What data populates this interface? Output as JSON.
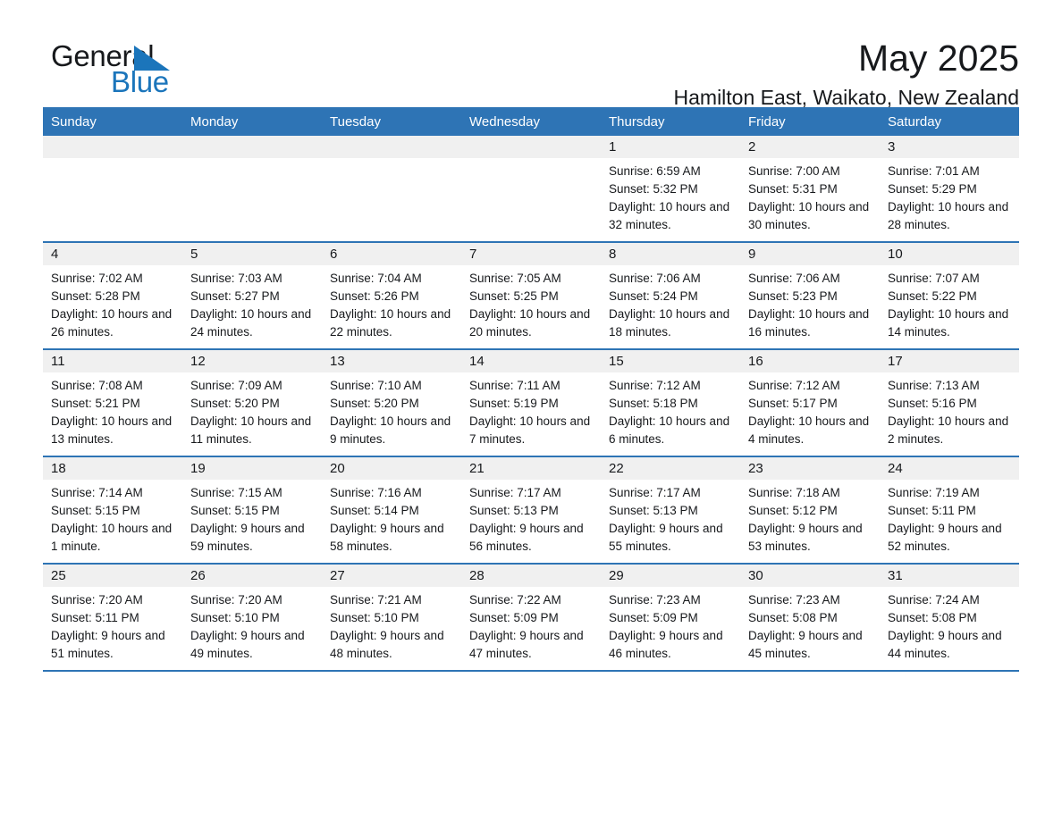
{
  "brand": {
    "name_part1": "General",
    "name_part2": "Blue",
    "accent_color": "#1b75bb",
    "triangle_icon": "triangle-icon"
  },
  "header": {
    "month_title": "May 2025",
    "location": "Hamilton East, Waikato, New Zealand"
  },
  "theme": {
    "header_blue": "#2e74b5",
    "day_band_gray": "#f0f0f0",
    "text_color": "#17191c"
  },
  "weekdays": [
    "Sunday",
    "Monday",
    "Tuesday",
    "Wednesday",
    "Thursday",
    "Friday",
    "Saturday"
  ],
  "weeks": [
    [
      {
        "day": "",
        "empty": true,
        "sunrise": "",
        "sunset": "",
        "daylight": ""
      },
      {
        "day": "",
        "empty": true,
        "sunrise": "",
        "sunset": "",
        "daylight": ""
      },
      {
        "day": "",
        "empty": true,
        "sunrise": "",
        "sunset": "",
        "daylight": ""
      },
      {
        "day": "",
        "empty": true,
        "sunrise": "",
        "sunset": "",
        "daylight": ""
      },
      {
        "day": "1",
        "empty": false,
        "sunrise": "Sunrise: 6:59 AM",
        "sunset": "Sunset: 5:32 PM",
        "daylight": "Daylight: 10 hours and 32 minutes."
      },
      {
        "day": "2",
        "empty": false,
        "sunrise": "Sunrise: 7:00 AM",
        "sunset": "Sunset: 5:31 PM",
        "daylight": "Daylight: 10 hours and 30 minutes."
      },
      {
        "day": "3",
        "empty": false,
        "sunrise": "Sunrise: 7:01 AM",
        "sunset": "Sunset: 5:29 PM",
        "daylight": "Daylight: 10 hours and 28 minutes."
      }
    ],
    [
      {
        "day": "4",
        "empty": false,
        "sunrise": "Sunrise: 7:02 AM",
        "sunset": "Sunset: 5:28 PM",
        "daylight": "Daylight: 10 hours and 26 minutes."
      },
      {
        "day": "5",
        "empty": false,
        "sunrise": "Sunrise: 7:03 AM",
        "sunset": "Sunset: 5:27 PM",
        "daylight": "Daylight: 10 hours and 24 minutes."
      },
      {
        "day": "6",
        "empty": false,
        "sunrise": "Sunrise: 7:04 AM",
        "sunset": "Sunset: 5:26 PM",
        "daylight": "Daylight: 10 hours and 22 minutes."
      },
      {
        "day": "7",
        "empty": false,
        "sunrise": "Sunrise: 7:05 AM",
        "sunset": "Sunset: 5:25 PM",
        "daylight": "Daylight: 10 hours and 20 minutes."
      },
      {
        "day": "8",
        "empty": false,
        "sunrise": "Sunrise: 7:06 AM",
        "sunset": "Sunset: 5:24 PM",
        "daylight": "Daylight: 10 hours and 18 minutes."
      },
      {
        "day": "9",
        "empty": false,
        "sunrise": "Sunrise: 7:06 AM",
        "sunset": "Sunset: 5:23 PM",
        "daylight": "Daylight: 10 hours and 16 minutes."
      },
      {
        "day": "10",
        "empty": false,
        "sunrise": "Sunrise: 7:07 AM",
        "sunset": "Sunset: 5:22 PM",
        "daylight": "Daylight: 10 hours and 14 minutes."
      }
    ],
    [
      {
        "day": "11",
        "empty": false,
        "sunrise": "Sunrise: 7:08 AM",
        "sunset": "Sunset: 5:21 PM",
        "daylight": "Daylight: 10 hours and 13 minutes."
      },
      {
        "day": "12",
        "empty": false,
        "sunrise": "Sunrise: 7:09 AM",
        "sunset": "Sunset: 5:20 PM",
        "daylight": "Daylight: 10 hours and 11 minutes."
      },
      {
        "day": "13",
        "empty": false,
        "sunrise": "Sunrise: 7:10 AM",
        "sunset": "Sunset: 5:20 PM",
        "daylight": "Daylight: 10 hours and 9 minutes."
      },
      {
        "day": "14",
        "empty": false,
        "sunrise": "Sunrise: 7:11 AM",
        "sunset": "Sunset: 5:19 PM",
        "daylight": "Daylight: 10 hours and 7 minutes."
      },
      {
        "day": "15",
        "empty": false,
        "sunrise": "Sunrise: 7:12 AM",
        "sunset": "Sunset: 5:18 PM",
        "daylight": "Daylight: 10 hours and 6 minutes."
      },
      {
        "day": "16",
        "empty": false,
        "sunrise": "Sunrise: 7:12 AM",
        "sunset": "Sunset: 5:17 PM",
        "daylight": "Daylight: 10 hours and 4 minutes."
      },
      {
        "day": "17",
        "empty": false,
        "sunrise": "Sunrise: 7:13 AM",
        "sunset": "Sunset: 5:16 PM",
        "daylight": "Daylight: 10 hours and 2 minutes."
      }
    ],
    [
      {
        "day": "18",
        "empty": false,
        "sunrise": "Sunrise: 7:14 AM",
        "sunset": "Sunset: 5:15 PM",
        "daylight": "Daylight: 10 hours and 1 minute."
      },
      {
        "day": "19",
        "empty": false,
        "sunrise": "Sunrise: 7:15 AM",
        "sunset": "Sunset: 5:15 PM",
        "daylight": "Daylight: 9 hours and 59 minutes."
      },
      {
        "day": "20",
        "empty": false,
        "sunrise": "Sunrise: 7:16 AM",
        "sunset": "Sunset: 5:14 PM",
        "daylight": "Daylight: 9 hours and 58 minutes."
      },
      {
        "day": "21",
        "empty": false,
        "sunrise": "Sunrise: 7:17 AM",
        "sunset": "Sunset: 5:13 PM",
        "daylight": "Daylight: 9 hours and 56 minutes."
      },
      {
        "day": "22",
        "empty": false,
        "sunrise": "Sunrise: 7:17 AM",
        "sunset": "Sunset: 5:13 PM",
        "daylight": "Daylight: 9 hours and 55 minutes."
      },
      {
        "day": "23",
        "empty": false,
        "sunrise": "Sunrise: 7:18 AM",
        "sunset": "Sunset: 5:12 PM",
        "daylight": "Daylight: 9 hours and 53 minutes."
      },
      {
        "day": "24",
        "empty": false,
        "sunrise": "Sunrise: 7:19 AM",
        "sunset": "Sunset: 5:11 PM",
        "daylight": "Daylight: 9 hours and 52 minutes."
      }
    ],
    [
      {
        "day": "25",
        "empty": false,
        "sunrise": "Sunrise: 7:20 AM",
        "sunset": "Sunset: 5:11 PM",
        "daylight": "Daylight: 9 hours and 51 minutes."
      },
      {
        "day": "26",
        "empty": false,
        "sunrise": "Sunrise: 7:20 AM",
        "sunset": "Sunset: 5:10 PM",
        "daylight": "Daylight: 9 hours and 49 minutes."
      },
      {
        "day": "27",
        "empty": false,
        "sunrise": "Sunrise: 7:21 AM",
        "sunset": "Sunset: 5:10 PM",
        "daylight": "Daylight: 9 hours and 48 minutes."
      },
      {
        "day": "28",
        "empty": false,
        "sunrise": "Sunrise: 7:22 AM",
        "sunset": "Sunset: 5:09 PM",
        "daylight": "Daylight: 9 hours and 47 minutes."
      },
      {
        "day": "29",
        "empty": false,
        "sunrise": "Sunrise: 7:23 AM",
        "sunset": "Sunset: 5:09 PM",
        "daylight": "Daylight: 9 hours and 46 minutes."
      },
      {
        "day": "30",
        "empty": false,
        "sunrise": "Sunrise: 7:23 AM",
        "sunset": "Sunset: 5:08 PM",
        "daylight": "Daylight: 9 hours and 45 minutes."
      },
      {
        "day": "31",
        "empty": false,
        "sunrise": "Sunrise: 7:24 AM",
        "sunset": "Sunset: 5:08 PM",
        "daylight": "Daylight: 9 hours and 44 minutes."
      }
    ]
  ]
}
